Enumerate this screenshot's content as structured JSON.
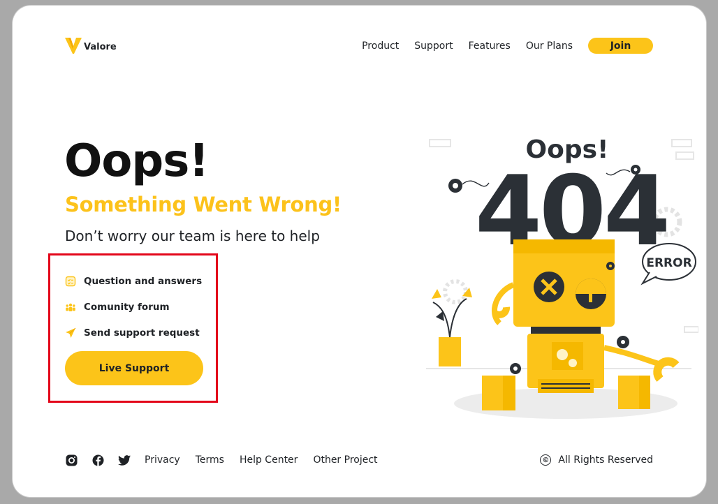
{
  "brand": {
    "name": "Valore",
    "color": "#fcc419"
  },
  "nav": {
    "links": [
      "Product",
      "Support",
      "Features",
      "Our Plans"
    ],
    "join_label": "Join"
  },
  "hero": {
    "title": "Oops!",
    "subtitle": "Something Went Wrong!",
    "description": "Don’t worry our team is here to help"
  },
  "help_options": [
    {
      "label": "Question and answers",
      "icon": "qa-icon"
    },
    {
      "label": "Comunity forum",
      "icon": "community-icon"
    },
    {
      "label": "Send support request",
      "icon": "send-icon"
    }
  ],
  "live_support_label": "Live Support",
  "illustration": {
    "heading": "Oops!",
    "code": "404",
    "badge": "ERROR"
  },
  "footer": {
    "social_icons": [
      "instagram-icon",
      "facebook-icon",
      "twitter-icon"
    ],
    "links": [
      "Privacy",
      "Terms",
      "Help Center",
      "Other Project"
    ],
    "copyright_icon": "©",
    "copyright": "All Rights Reserved"
  },
  "colors": {
    "accent": "#fcc419",
    "dark": "#2b3036",
    "highlight": "#e3061a"
  }
}
